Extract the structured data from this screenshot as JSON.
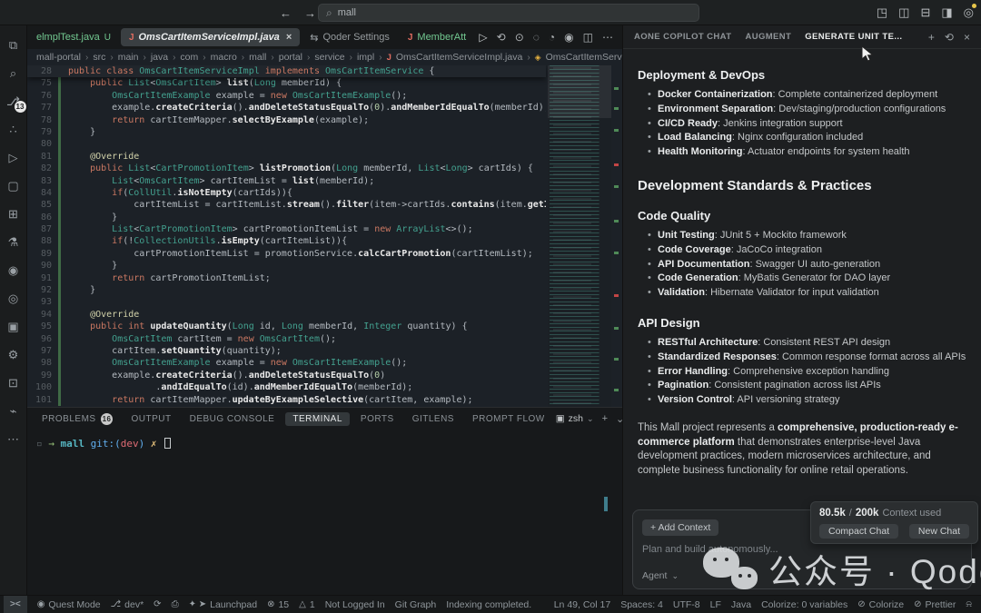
{
  "theme": {
    "accent_green": "#3db474",
    "badge_bg": "#e8e8e8",
    "keyword": "#cb7862",
    "type": "#43a18f"
  },
  "titlebar": {
    "back": "←",
    "forward": "→",
    "search_icon": "⌕",
    "search_value": "mall",
    "right_icons": [
      {
        "name": "layout-customize-icon",
        "glyph": "◳"
      },
      {
        "name": "sidebar-left-icon",
        "glyph": "◫"
      },
      {
        "name": "panel-bottom-icon",
        "glyph": "⊟"
      },
      {
        "name": "sidebar-right-icon",
        "glyph": "◨"
      },
      {
        "name": "account-icon",
        "glyph": "◎"
      }
    ]
  },
  "activity_bar": {
    "items": [
      {
        "name": "explorer-icon",
        "glyph": "⧉"
      },
      {
        "name": "search-icon",
        "glyph": "⌕"
      },
      {
        "name": "source-control-icon",
        "glyph": "⎇",
        "badge": "13"
      },
      {
        "name": "augment-icon",
        "glyph": "∴"
      },
      {
        "name": "run-debug-icon",
        "glyph": "▷"
      },
      {
        "name": "remote-explorer-icon",
        "glyph": "▢"
      },
      {
        "name": "extensions-icon",
        "glyph": "⊞"
      },
      {
        "name": "testing-icon",
        "glyph": "⚗"
      },
      {
        "name": "run-profile-icon",
        "glyph": "◉"
      },
      {
        "name": "playback-icon",
        "glyph": "◎"
      },
      {
        "name": "docker-icon",
        "glyph": "▣"
      },
      {
        "name": "settings-gear-icon",
        "glyph": "⚙"
      },
      {
        "name": "file-settings-icon",
        "glyph": "⊡"
      },
      {
        "name": "plug-icon",
        "glyph": "⌁"
      },
      {
        "name": "more-icon",
        "glyph": "⋯"
      }
    ]
  },
  "editor_tabs": [
    {
      "label": "elmplTest.java",
      "decoration": "U",
      "green": true
    },
    {
      "label": "OmsCartItemServiceImpl.java",
      "icon": "J",
      "active": true,
      "close": "×"
    },
    {
      "label": "Qoder Settings",
      "gicon": "⇆"
    },
    {
      "label": "MemberAtt",
      "icon": "J",
      "green": true
    }
  ],
  "editor_actions": [
    {
      "name": "run-button",
      "glyph": "▷"
    },
    {
      "name": "run-history-icon",
      "glyph": "⟲"
    },
    {
      "name": "step-back-icon",
      "glyph": "⊙"
    },
    {
      "name": "record-icon",
      "glyph": "◌"
    },
    {
      "name": "coverage-icon",
      "glyph": "◔"
    },
    {
      "name": "play-circle-icon",
      "glyph": "◉"
    },
    {
      "name": "split-editor-icon",
      "glyph": "◫"
    },
    {
      "name": "more-actions-icon",
      "glyph": "⋯"
    }
  ],
  "breadcrumb": {
    "path": [
      "mall-portal",
      "src",
      "main",
      "java",
      "com",
      "macro",
      "mall",
      "portal",
      "service",
      "impl"
    ],
    "file": {
      "icon": "J",
      "label": "OmsCartItemServiceImpl.java"
    },
    "symbol": {
      "icon": "◈",
      "label": "OmsCartItemServic"
    }
  },
  "code": {
    "sticky": {
      "num": 28,
      "text": "public class OmsCartItemServiceImpl implements OmsCartItemService {"
    },
    "lines": [
      {
        "num": 75,
        "text": "    public List<OmsCartItem> list(Long memberId) {"
      },
      {
        "num": 76,
        "text": "        OmsCartItemExample example = new OmsCartItemExample();"
      },
      {
        "num": 77,
        "text": "        example.createCriteria().andDeleteStatusEqualTo(0).andMemberIdEqualTo(memberId);"
      },
      {
        "num": 78,
        "text": "        return cartItemMapper.selectByExample(example);"
      },
      {
        "num": 79,
        "text": "    }"
      },
      {
        "num": 80,
        "text": ""
      },
      {
        "num": 81,
        "text": "    @Override"
      },
      {
        "num": 82,
        "text": "    public List<CartPromotionItem> listPromotion(Long memberId, List<Long> cartIds) {"
      },
      {
        "num": 83,
        "text": "        List<OmsCartItem> cartItemList = list(memberId);"
      },
      {
        "num": 84,
        "text": "        if(CollUtil.isNotEmpty(cartIds)){"
      },
      {
        "num": 85,
        "text": "            cartItemList = cartItemList.stream().filter(item->cartIds.contains(item.getId()))."
      },
      {
        "num": 86,
        "text": "        }"
      },
      {
        "num": 87,
        "text": "        List<CartPromotionItem> cartPromotionItemList = new ArrayList<>();"
      },
      {
        "num": 88,
        "text": "        if(!CollectionUtils.isEmpty(cartItemList)){"
      },
      {
        "num": 89,
        "text": "            cartPromotionItemList = promotionService.calcCartPromotion(cartItemList);"
      },
      {
        "num": 90,
        "text": "        }"
      },
      {
        "num": 91,
        "text": "        return cartPromotionItemList;"
      },
      {
        "num": 92,
        "text": "    }"
      },
      {
        "num": 93,
        "text": ""
      },
      {
        "num": 94,
        "text": "    @Override"
      },
      {
        "num": 95,
        "text": "    public int updateQuantity(Long id, Long memberId, Integer quantity) {"
      },
      {
        "num": 96,
        "text": "        OmsCartItem cartItem = new OmsCartItem();"
      },
      {
        "num": 97,
        "text": "        cartItem.setQuantity(quantity);"
      },
      {
        "num": 98,
        "text": "        OmsCartItemExample example = new OmsCartItemExample();"
      },
      {
        "num": 99,
        "text": "        example.createCriteria().andDeleteStatusEqualTo(0)"
      },
      {
        "num": 100,
        "text": "                .andIdEqualTo(id).andMemberIdEqualTo(memberId);"
      },
      {
        "num": 101,
        "text": "        return cartItemMapper.updateByExampleSelective(cartItem, example);"
      }
    ]
  },
  "panel": {
    "tabs": [
      {
        "label": "PROBLEMS",
        "badge": "16"
      },
      {
        "label": "OUTPUT"
      },
      {
        "label": "DEBUG CONSOLE"
      },
      {
        "label": "TERMINAL",
        "active": true
      },
      {
        "label": "PORTS"
      },
      {
        "label": "GITLENS"
      },
      {
        "label": "PROMPT FLOW"
      }
    ],
    "shell": {
      "icon": "▣",
      "label": "zsh"
    },
    "controls": [
      {
        "name": "new-terminal-icon",
        "glyph": "+"
      },
      {
        "name": "terminal-dropdown-icon",
        "glyph": "⌄"
      },
      {
        "name": "split-terminal-icon",
        "glyph": "◫"
      },
      {
        "name": "kill-terminal-icon",
        "glyph": "⊟"
      },
      {
        "name": "more-icon",
        "glyph": "⋯"
      },
      {
        "name": "maximize-panel-icon",
        "glyph": "∧"
      },
      {
        "name": "close-panel-icon",
        "glyph": "×"
      }
    ],
    "prompt": [
      {
        "t": "▫ ",
        "c": "dim"
      },
      {
        "t": "→  ",
        "c": "green"
      },
      {
        "t": "mall ",
        "c": "cyan"
      },
      {
        "t": "git:(",
        "c": "blue"
      },
      {
        "t": "dev",
        "c": "red"
      },
      {
        "t": ") ",
        "c": "blue"
      },
      {
        "t": "✗ ",
        "c": "yellow"
      }
    ]
  },
  "assistant": {
    "tabs": [
      {
        "label": "AONE COPILOT CHAT"
      },
      {
        "label": "AUGMENT"
      },
      {
        "label": "GENERATE UNIT TE...",
        "active": true
      }
    ],
    "controls": [
      {
        "name": "add-chat-icon",
        "glyph": "+"
      },
      {
        "name": "history-icon",
        "glyph": "⟲"
      },
      {
        "name": "close-icon",
        "glyph": "×"
      }
    ],
    "sections": [
      {
        "type": "h3",
        "text": "Deployment & DevOps"
      },
      {
        "type": "bullets",
        "items": [
          [
            "Docker Containerization",
            ": Complete containerized deployment"
          ],
          [
            "Environment Separation",
            ": Dev/staging/production configurations"
          ],
          [
            "CI/CD Ready",
            ": Jenkins integration support"
          ],
          [
            "Load Balancing",
            ": Nginx configuration included"
          ],
          [
            "Health Monitoring",
            ": Actuator endpoints for system health"
          ]
        ]
      },
      {
        "type": "h2",
        "text": "Development Standards & Practices"
      },
      {
        "type": "h3",
        "text": "Code Quality"
      },
      {
        "type": "bullets",
        "items": [
          [
            "Unit Testing",
            ": JUnit 5 + Mockito framework"
          ],
          [
            "Code Coverage",
            ": JaCoCo integration"
          ],
          [
            "API Documentation",
            ": Swagger UI auto-generation"
          ],
          [
            "Code Generation",
            ": MyBatis Generator for DAO layer"
          ],
          [
            "Validation",
            ": Hibernate Validator for input validation"
          ]
        ]
      },
      {
        "type": "h3",
        "text": "API Design"
      },
      {
        "type": "bullets",
        "items": [
          [
            "RESTful Architecture",
            ": Consistent REST API design"
          ],
          [
            "Standardized Responses",
            ": Common response format across all APIs"
          ],
          [
            "Error Handling",
            ": Comprehensive exception handling"
          ],
          [
            "Pagination",
            ": Consistent pagination across list APIs"
          ],
          [
            "Version Control",
            ": API versioning strategy"
          ]
        ]
      },
      {
        "type": "p",
        "runs": [
          {
            "text": "This Mall project represents a ",
            "bold": false
          },
          {
            "text": "comprehensive, production-ready e-commerce platform",
            "bold": true
          },
          {
            "text": " that demonstrates enterprise-level Java development practices, modern microservices architecture, and complete business functionality for online retail operations.",
            "bold": false
          }
        ]
      }
    ],
    "input": {
      "add_context_label": "+ Add Context",
      "placeholder": "Plan and build autonomously...",
      "mode_label": "Agent"
    },
    "context_popup": {
      "used": "80.5k",
      "separator": "/",
      "total": "200k",
      "label": "Context used",
      "buttons": [
        "Compact Chat",
        "New Chat"
      ]
    }
  },
  "watermark": {
    "text": "公众号 · Qoder"
  },
  "status_bar": {
    "left": [
      {
        "name": "remote-icon",
        "i": "><",
        "cls": "remote"
      },
      {
        "name": "quest-mode",
        "i": "◉",
        "t": "Quest Mode"
      },
      {
        "name": "git-branch",
        "i": "⎇",
        "t": "dev*"
      },
      {
        "name": "sync-icon",
        "i": "⟳"
      },
      {
        "name": "stamp-icon",
        "i": "⎙"
      },
      {
        "name": "launchpad",
        "i": "✦ ➤",
        "t": "Launchpad"
      },
      {
        "name": "errors",
        "i": "⊗",
        "t": "15"
      },
      {
        "name": "warnings",
        "i": "△",
        "t": "1"
      },
      {
        "name": "not-logged-in",
        "t": "Not Logged In"
      },
      {
        "name": "git-graph",
        "t": "Git Graph"
      },
      {
        "name": "indexing-status",
        "t": "Indexing completed."
      }
    ],
    "right": [
      {
        "name": "cursor-position",
        "t": "Ln 49, Col 17"
      },
      {
        "name": "indentation",
        "t": "Spaces: 4"
      },
      {
        "name": "encoding",
        "t": "UTF-8"
      },
      {
        "name": "eol",
        "t": "LF"
      },
      {
        "name": "language-mode",
        "t": "Java"
      },
      {
        "name": "colorize-variables",
        "t": "Colorize: 0 variables"
      },
      {
        "name": "colorize-toggle",
        "i": "⊘",
        "t": "Colorize"
      },
      {
        "name": "prettier-toggle",
        "i": "⊘",
        "t": "Prettier"
      },
      {
        "name": "notifications-icon",
        "i": "⍾"
      }
    ]
  }
}
